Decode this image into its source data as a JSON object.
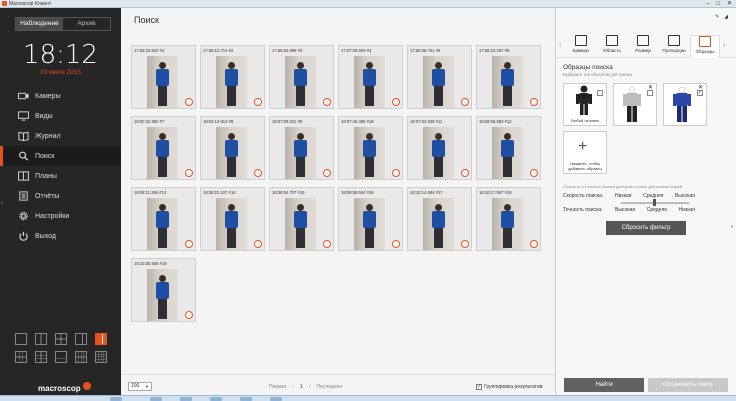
{
  "window": {
    "title": "Macroscop Клиент",
    "controls": [
      "–",
      "□",
      "✕"
    ]
  },
  "sidebar": {
    "mode_tabs": [
      {
        "label": "Наблюдение",
        "active": true
      },
      {
        "label": "Архив",
        "active": false
      }
    ],
    "time": "18:12",
    "date": "10 июля 2015",
    "nav": [
      {
        "label": "Камеры",
        "icon": "camera-icon"
      },
      {
        "label": "Виды",
        "icon": "monitor-icon"
      },
      {
        "label": "Журнал",
        "icon": "journal-icon"
      },
      {
        "label": "Поиск",
        "icon": "search-icon",
        "active": true
      },
      {
        "label": "Планы",
        "icon": "plans-icon"
      },
      {
        "label": "Отчёты",
        "icon": "reports-icon"
      },
      {
        "label": "Настройки",
        "icon": "gear-icon"
      },
      {
        "label": "Выход",
        "icon": "power-icon"
      }
    ],
    "logo": "macroscop"
  },
  "main": {
    "title": "Поиск",
    "results": [
      "17:55:23.842 #1",
      "17:56:12.714 #2",
      "17:56:52.898 #3",
      "17:57:08.509 #4",
      "17:58:08.761 #5",
      "17:58:23.267 #6",
      "18:00:32.882 #7",
      "18:04:13.913 #8",
      "18:07:08.031 #9",
      "18:07:46.486 #10",
      "18:07:52.938 #11",
      "18:08:06.583 #12",
      "18:08:11.359 #13",
      "18:08:22.107 #14",
      "18:08:54.707 #15",
      "18:09:58.554 #16",
      "18:10:14.584 #17",
      "18:10:17.597 #18",
      "18:10:35.936 #19"
    ],
    "per_page": "100",
    "pager": {
      "first": "Первая",
      "prev": "‹",
      "current": "1",
      "next": "›",
      "last": "Последняя"
    },
    "grouping_label": "Группировка результатов",
    "grouping_checked": true
  },
  "right_panel": {
    "tabs": [
      {
        "label": "Камеры",
        "icon": "cameras-tool-icon"
      },
      {
        "label": "Область",
        "icon": "area-icon"
      },
      {
        "label": "Размер",
        "icon": "size-icon"
      },
      {
        "label": "Пропорции",
        "icon": "proportions-icon"
      },
      {
        "label": "Образцы",
        "icon": "samples-icon",
        "active": true
      }
    ],
    "samples_title": "Образцы поиска",
    "samples_subtitle": "Выберите тип объектов для поиска",
    "samples": [
      {
        "caption": "Любой человек"
      },
      {
        "caption": ""
      },
      {
        "caption": ""
      }
    ],
    "add_sample_caption": "Нажмите, чтобы добавить образец",
    "settings_hint": "Скорость и точность поиска доступны только для поиска людей",
    "speed_label": "Скорость поиска:",
    "speed_options": [
      "Низкая",
      "Средняя",
      "Высокая"
    ],
    "accuracy_label": "Точность поиска:",
    "accuracy_options": [
      "Высокая",
      "Средняя",
      "Низкая"
    ],
    "reset_label": "Сбросить фильтр",
    "find_label": "Найти",
    "stop_label": "Остановить поиск"
  },
  "colors": {
    "accent": "#e6531f",
    "sidebar_bg": "#262626",
    "shirt": "#1f4fa3"
  }
}
